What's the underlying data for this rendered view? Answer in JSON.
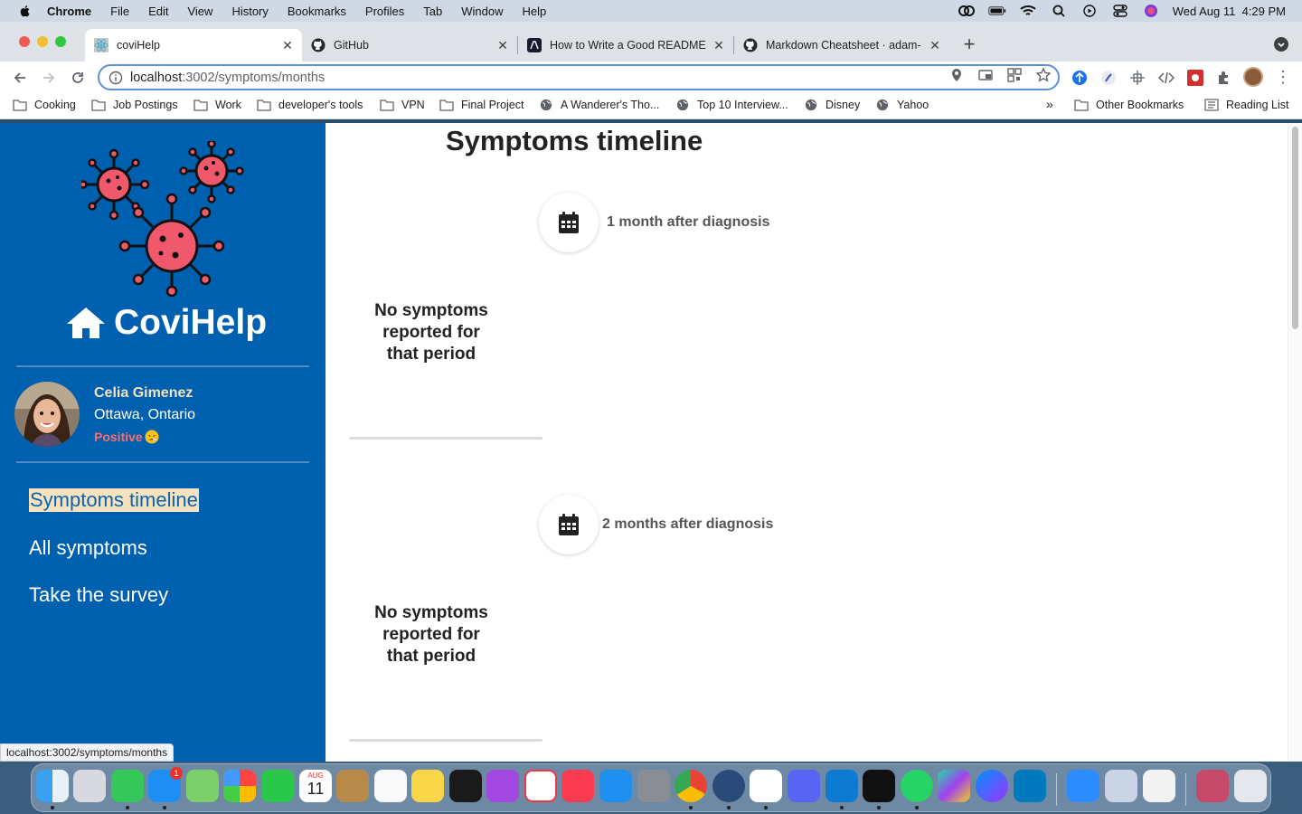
{
  "menubar": {
    "app": "Chrome",
    "items": [
      "File",
      "Edit",
      "View",
      "History",
      "Bookmarks",
      "Profiles",
      "Tab",
      "Window",
      "Help"
    ],
    "datetime": "Wed Aug 11  4:29 PM"
  },
  "tabs": [
    {
      "label": "coviHelp",
      "icon": "react-icon",
      "active": true
    },
    {
      "label": "GitHub",
      "icon": "github-icon",
      "active": false
    },
    {
      "label": "How to Write a Good README",
      "icon": "article-icon",
      "active": false
    },
    {
      "label": "Markdown Cheatsheet · adam-",
      "icon": "github-icon",
      "active": false
    }
  ],
  "omnibox": {
    "host": "localhost",
    "path": ":3002/symptoms/months"
  },
  "bookmarks": [
    {
      "label": "Cooking",
      "icon": "folder-icon"
    },
    {
      "label": "Job Postings",
      "icon": "folder-icon"
    },
    {
      "label": "Work",
      "icon": "folder-icon"
    },
    {
      "label": "developer's tools",
      "icon": "folder-icon"
    },
    {
      "label": "VPN",
      "icon": "folder-icon"
    },
    {
      "label": "Final Project",
      "icon": "folder-icon"
    },
    {
      "label": "A Wanderer's Tho...",
      "icon": "globe-icon"
    },
    {
      "label": "Top 10 Interview...",
      "icon": "globe-icon"
    },
    {
      "label": "Disney",
      "icon": "globe-icon"
    },
    {
      "label": "Yahoo",
      "icon": "globe-icon"
    }
  ],
  "bookmarks_right": {
    "more": "»",
    "other": "Other Bookmarks",
    "reading": "Reading List"
  },
  "sidebar": {
    "brand": "CoviHelp",
    "user": {
      "name": "Celia Gimenez",
      "location": "Ottawa, Ontario",
      "status": "Positive"
    },
    "nav": [
      "Symptoms timeline",
      "All symptoms",
      "Take the survey"
    ]
  },
  "main": {
    "title": "Symptoms timeline",
    "periods": [
      {
        "label": "1 month after diagnosis",
        "message": "No symptoms reported for that period"
      },
      {
        "label": "2 months after diagnosis",
        "message": "No symptoms reported for that period"
      }
    ]
  },
  "statusbar": "localhost:3002/symptoms/months",
  "colors": {
    "sidebar": "#0060b0",
    "highlight": "#f7e2c0",
    "positive": "#ff6b6b"
  },
  "dock": {
    "calendar_day": "11",
    "calendar_month": "AUG",
    "mail_badge": "1"
  }
}
